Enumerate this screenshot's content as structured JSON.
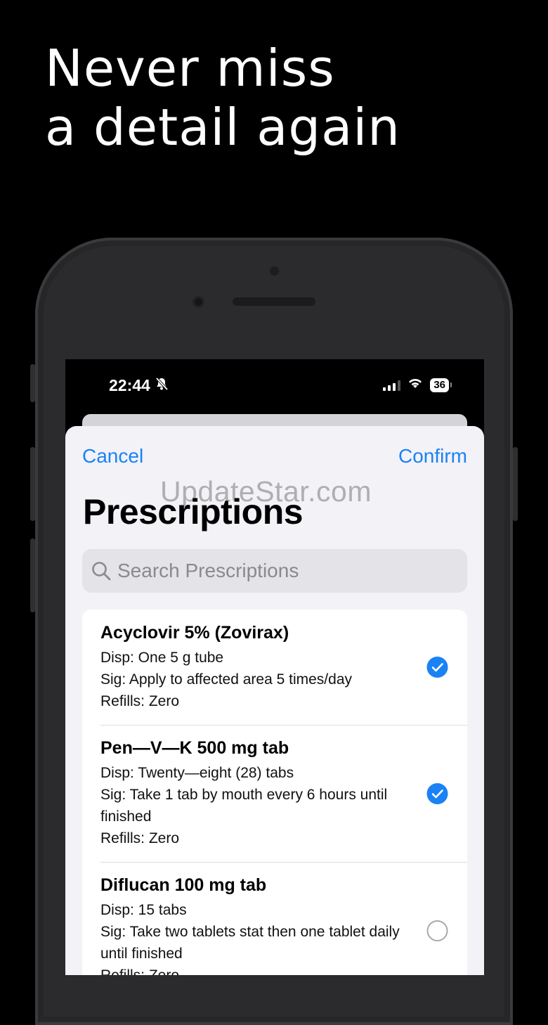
{
  "headline": {
    "line1": "Never miss",
    "line2": "a detail again"
  },
  "status_bar": {
    "time": "22:44",
    "battery": "36"
  },
  "nav": {
    "cancel": "Cancel",
    "confirm": "Confirm"
  },
  "watermark": "UpdateStar.com",
  "page_title": "Prescriptions",
  "search": {
    "placeholder": "Search Prescriptions"
  },
  "prescriptions": [
    {
      "name": "Acyclovir 5% (Zovirax)",
      "disp": "Disp: One 5 g tube",
      "sig": "Sig: Apply to affected area 5 times/day",
      "refills": "Refills: Zero",
      "selected": true
    },
    {
      "name": "Pen—V—K 500 mg tab",
      "disp": "Disp: Twenty—eight (28) tabs",
      "sig": "Sig: Take 1 tab by mouth every 6 hours until finished",
      "refills": "Refills: Zero",
      "selected": true
    },
    {
      "name": "Diflucan 100 mg tab",
      "disp": "Disp: 15 tabs",
      "sig": "Sig: Take two tablets stat then one tablet daily until finished",
      "refills": "Refills: Zero",
      "selected": false
    }
  ],
  "colors": {
    "accent": "#1a82f4",
    "sheet_bg": "#f2f2f7",
    "phone_body": "#2b2b2d"
  }
}
